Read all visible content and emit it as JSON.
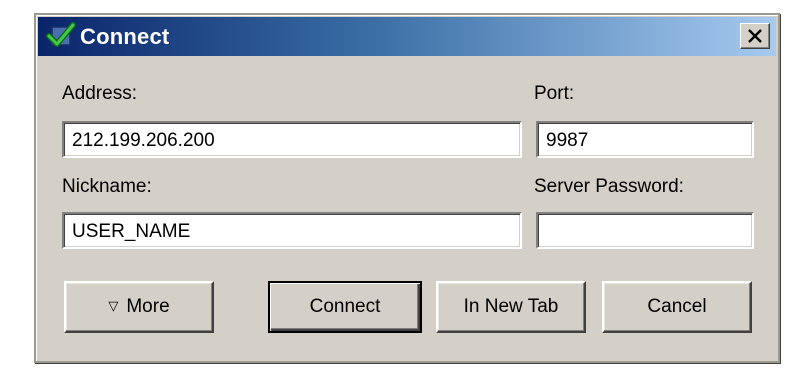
{
  "window": {
    "title": "Connect",
    "title_icon": "green-check-icon",
    "close_icon": "close-icon"
  },
  "form": {
    "address_label": "Address:",
    "address_value": "212.199.206.200",
    "port_label": "Port:",
    "port_value": "9987",
    "nickname_label": "Nickname:",
    "nickname_value": "USER_NAME",
    "password_label": "Server Password:",
    "password_value": ""
  },
  "buttons": {
    "more_label": "More",
    "more_icon": "triangle-down-icon",
    "connect_label": "Connect",
    "new_tab_label": "In New Tab",
    "cancel_label": "Cancel"
  },
  "colors": {
    "titlebar_start": "#0a246a",
    "titlebar_end": "#a6caf0",
    "dialog_bg": "#d4d0c8"
  }
}
